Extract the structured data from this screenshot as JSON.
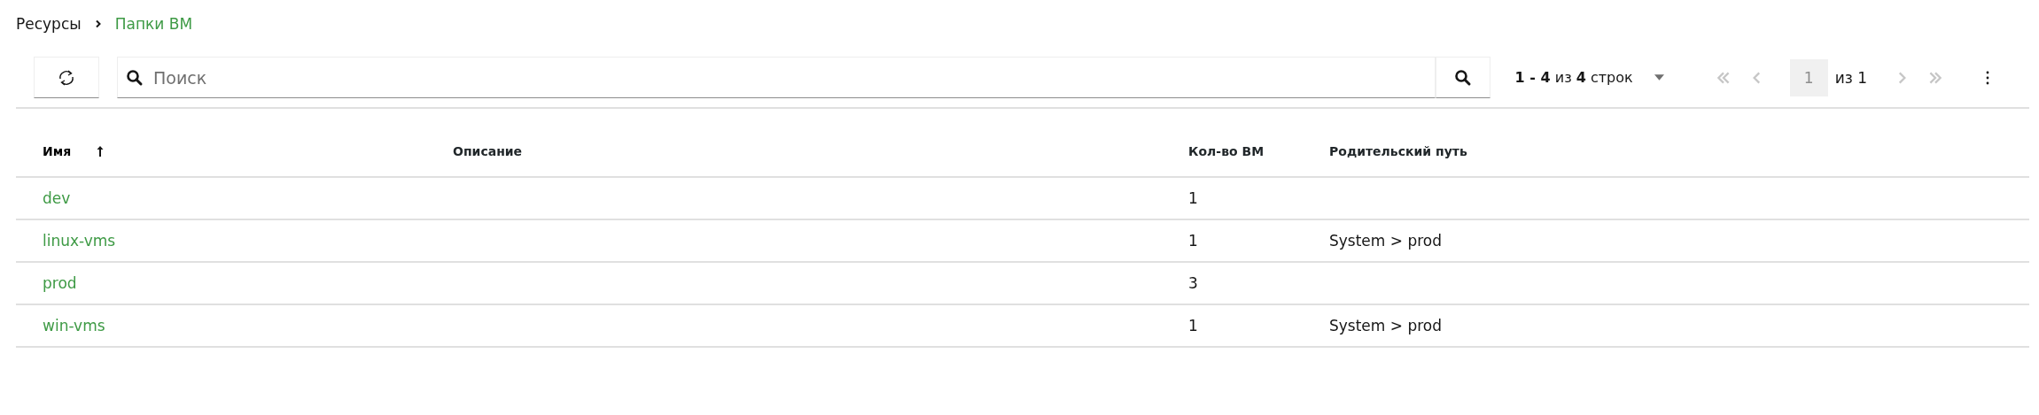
{
  "breadcrumb": [
    {
      "label": "Ресурсы",
      "current": false
    },
    {
      "label": "Папки ВМ",
      "current": true
    }
  ],
  "toolbar": {
    "search": {
      "placeholder": "Поиск"
    },
    "range": "**1 - 4** из **4** строк",
    "page": "1",
    "page_total": "из 1",
    "first_disabled": true,
    "prev_disabled": true,
    "next_disabled": true,
    "last_disabled": true
  },
  "table": {
    "columns": [
      {
        "label": "Имя",
        "sortable": true,
        "sorted": true
      },
      {
        "label": "Описание",
        "sortable": false,
        "sorted": false
      },
      {
        "label": "Кол-во ВМ",
        "sortable": true,
        "sorted": false
      },
      {
        "label": "Родительский путь",
        "sortable": false,
        "sorted": false
      }
    ],
    "rows": [
      {
        "name": "dev",
        "count": "1"
      },
      {
        "name": "linux-vms",
        "count": "1",
        "path": "System > prod"
      },
      {
        "name": "prod",
        "count": "3"
      },
      {
        "name": "win-vms",
        "count": "1",
        "path": "System > prod"
      }
    ]
  }
}
